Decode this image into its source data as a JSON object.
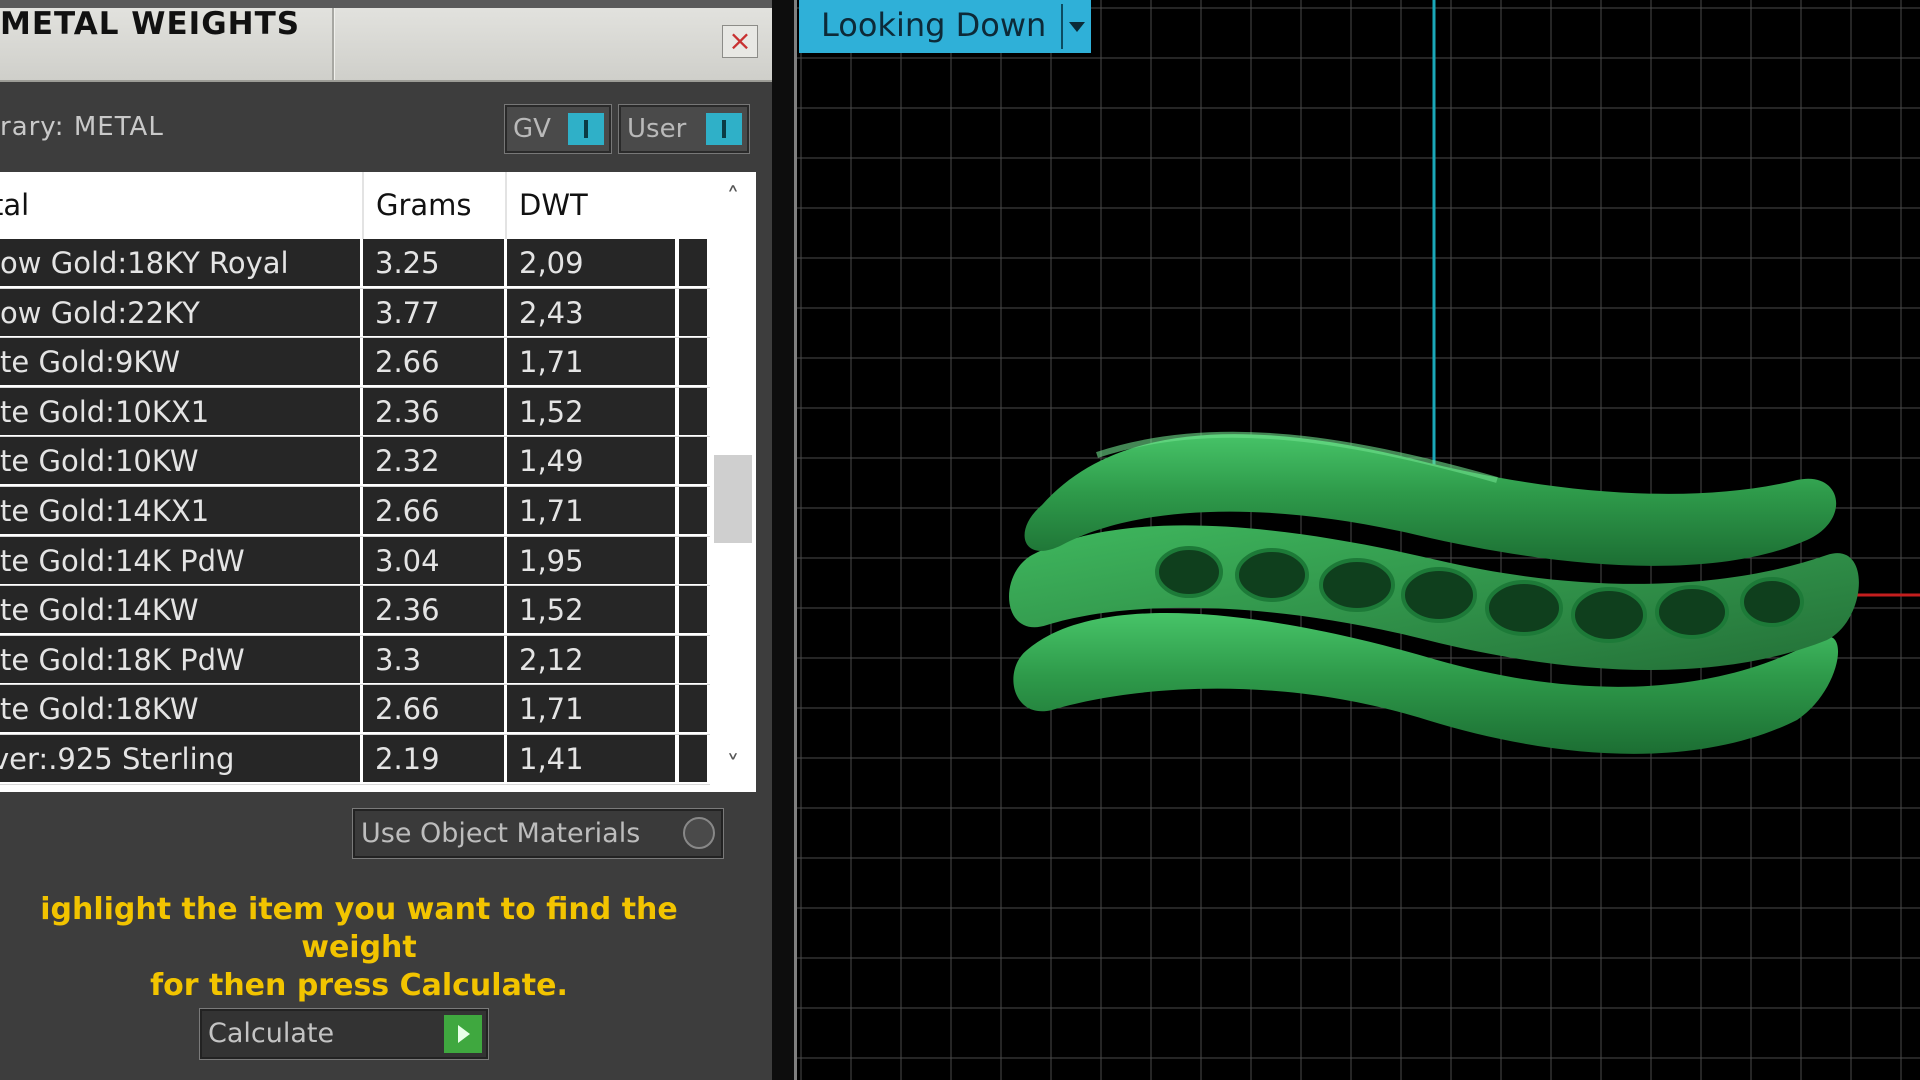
{
  "panel": {
    "title": "METAL WEIGHTS",
    "close_icon": "×",
    "library_label": "rary: METAL",
    "toggles": {
      "gv_label": "GV",
      "user_label": "User"
    },
    "table": {
      "headers": {
        "metal": "tal",
        "grams": "Grams",
        "dwt": "DWT"
      },
      "rows": [
        {
          "metal": "low Gold:18KY Royal",
          "grams": "3.25",
          "dwt": "2,09"
        },
        {
          "metal": "low Gold:22KY",
          "grams": "3.77",
          "dwt": "2,43"
        },
        {
          "metal": "ite Gold:9KW",
          "grams": "2.66",
          "dwt": "1,71"
        },
        {
          "metal": "ite Gold:10KX1",
          "grams": "2.36",
          "dwt": "1,52"
        },
        {
          "metal": "ite Gold:10KW",
          "grams": "2.32",
          "dwt": "1,49"
        },
        {
          "metal": "ite Gold:14KX1",
          "grams": "2.66",
          "dwt": "1,71"
        },
        {
          "metal": "ite Gold:14K PdW",
          "grams": "3.04",
          "dwt": "1,95"
        },
        {
          "metal": "ite Gold:14KW",
          "grams": "2.36",
          "dwt": "1,52"
        },
        {
          "metal": "ite Gold:18K PdW",
          "grams": "3.3",
          "dwt": "2,12"
        },
        {
          "metal": "ite Gold:18KW",
          "grams": "2.66",
          "dwt": "1,71"
        },
        {
          "metal": "ver:.925 Sterling",
          "grams": "2.19",
          "dwt": "1,41"
        }
      ],
      "scroll_up_icon": "˄",
      "scroll_down_icon": "˅"
    },
    "use_object_materials_label": "Use Object Materials",
    "instructions_line1": "ighlight the item you want to find the weight",
    "instructions_line2": "for then press Calculate.",
    "calculate_label": "Calculate"
  },
  "viewport": {
    "view_label": "Looking Down",
    "colors": {
      "grid": "#4a4a4a",
      "axis_vertical": "#1aa7b8",
      "axis_horizontal": "#c41e1e",
      "model": "#2e9a4a",
      "dropdown": "#2fb0d8"
    }
  }
}
